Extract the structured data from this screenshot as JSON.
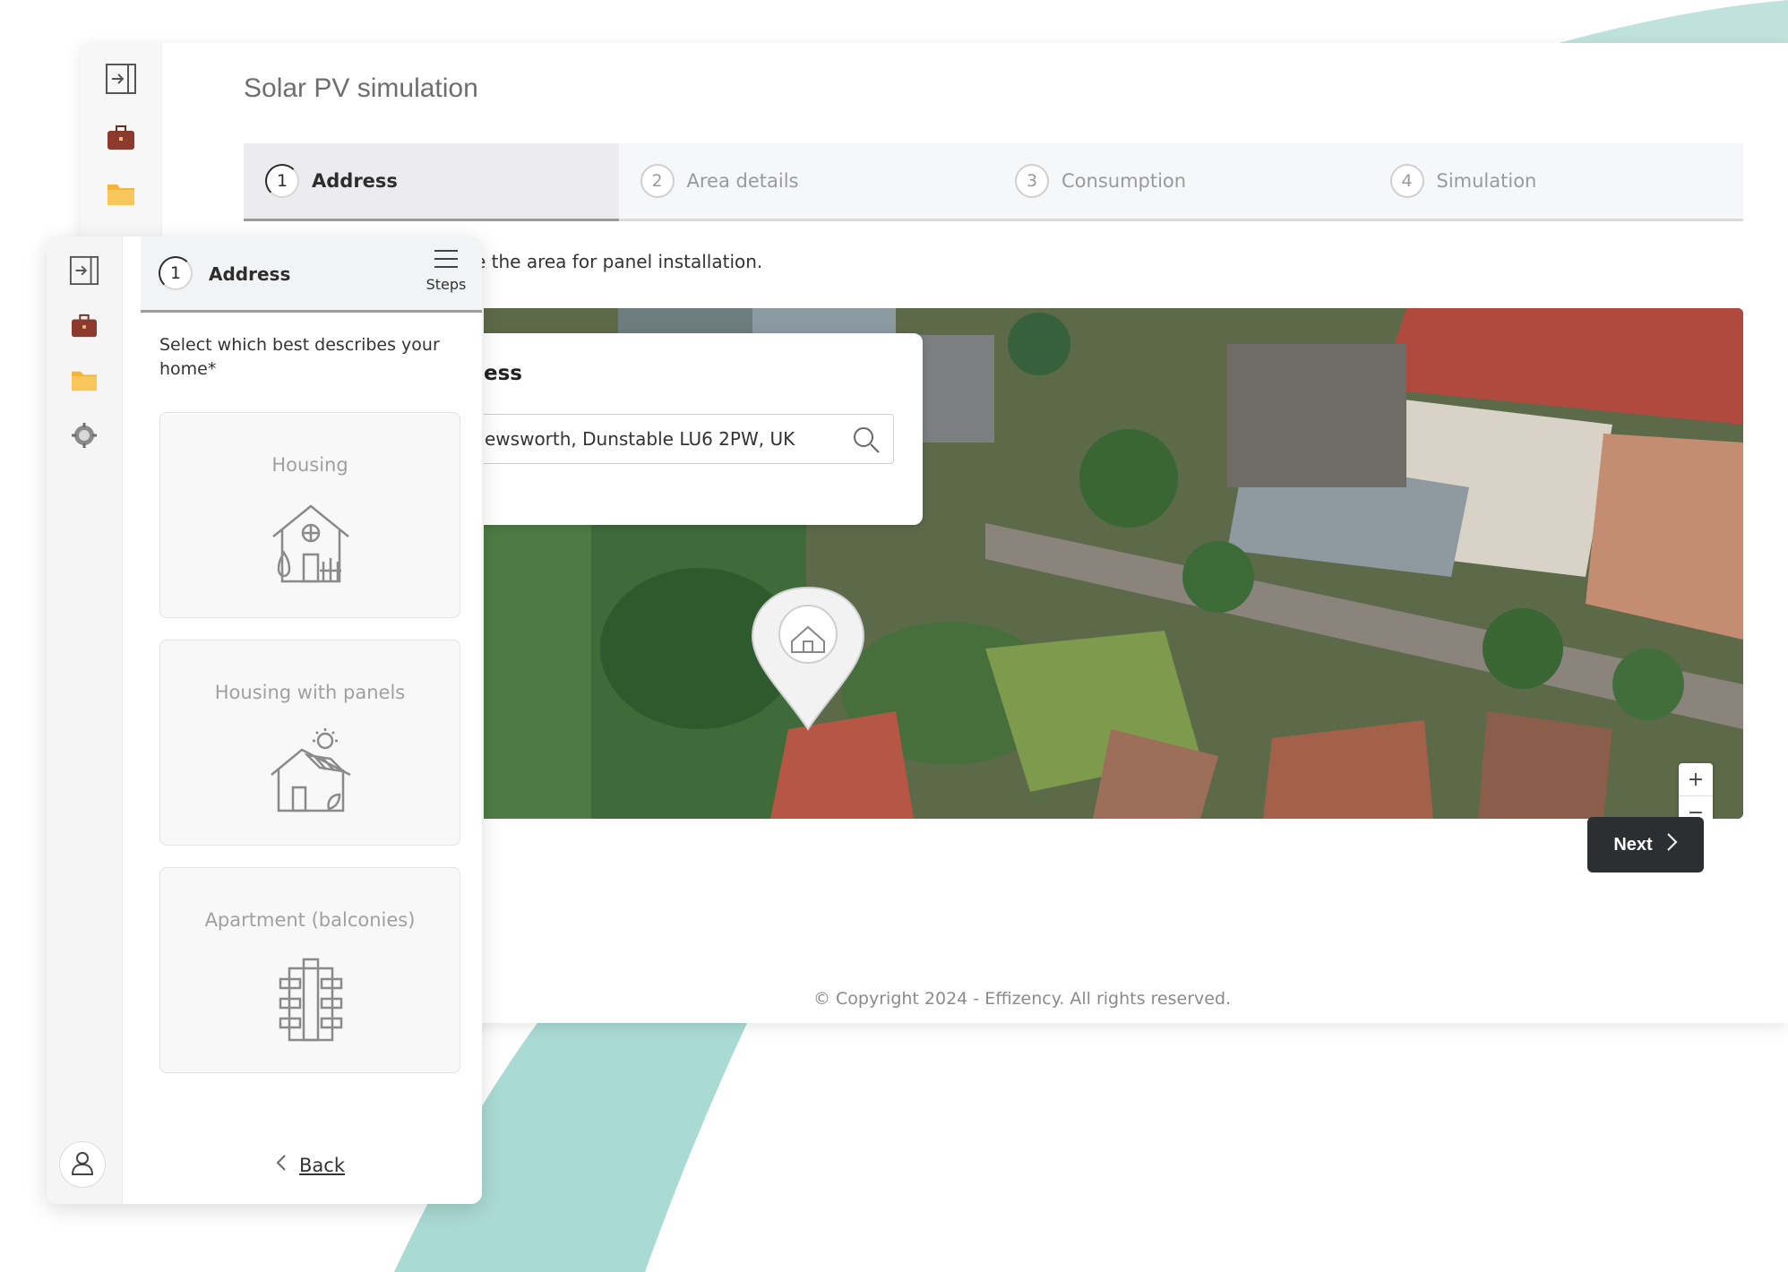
{
  "app": {
    "title": "Solar PV simulation"
  },
  "stepper": {
    "steps": [
      {
        "num": "1",
        "label": "Address"
      },
      {
        "num": "2",
        "label": "Area details"
      },
      {
        "num": "3",
        "label": "Consumption"
      },
      {
        "num": "4",
        "label": "Simulation"
      }
    ],
    "active_index": 0
  },
  "main": {
    "instruction": "e the area for panel installation.",
    "address_card_title": "ess",
    "address_value": "ewsworth, Dunstable LU6 2PW, UK",
    "zoom_in": "+",
    "zoom_out": "−",
    "next_label": "Next",
    "copyright": "© Copyright 2024 - Effizency. All rights reserved."
  },
  "mobile": {
    "step_num": "1",
    "step_label": "Address",
    "steps_label": "Steps",
    "question": "Select which best describes your home*",
    "options": [
      {
        "label": "Housing",
        "icon": "house-icon"
      },
      {
        "label": "Housing with panels",
        "icon": "house-solar-panels-icon"
      },
      {
        "label": "Apartment (balconies)",
        "icon": "apartment-building-icon"
      }
    ],
    "back_label": "Back"
  },
  "icons": {
    "rail": [
      "login-icon",
      "briefcase-icon",
      "folder-icon",
      "settings-gear-icon"
    ],
    "avatar": "user-icon",
    "search": "search-icon",
    "map_marker": "home-map-marker-icon"
  },
  "colors": {
    "accent_teal": "#a8dbd3",
    "next_button": "#2c2f31",
    "briefcase": "#8b3a2b",
    "folder": "#f2b53a"
  }
}
